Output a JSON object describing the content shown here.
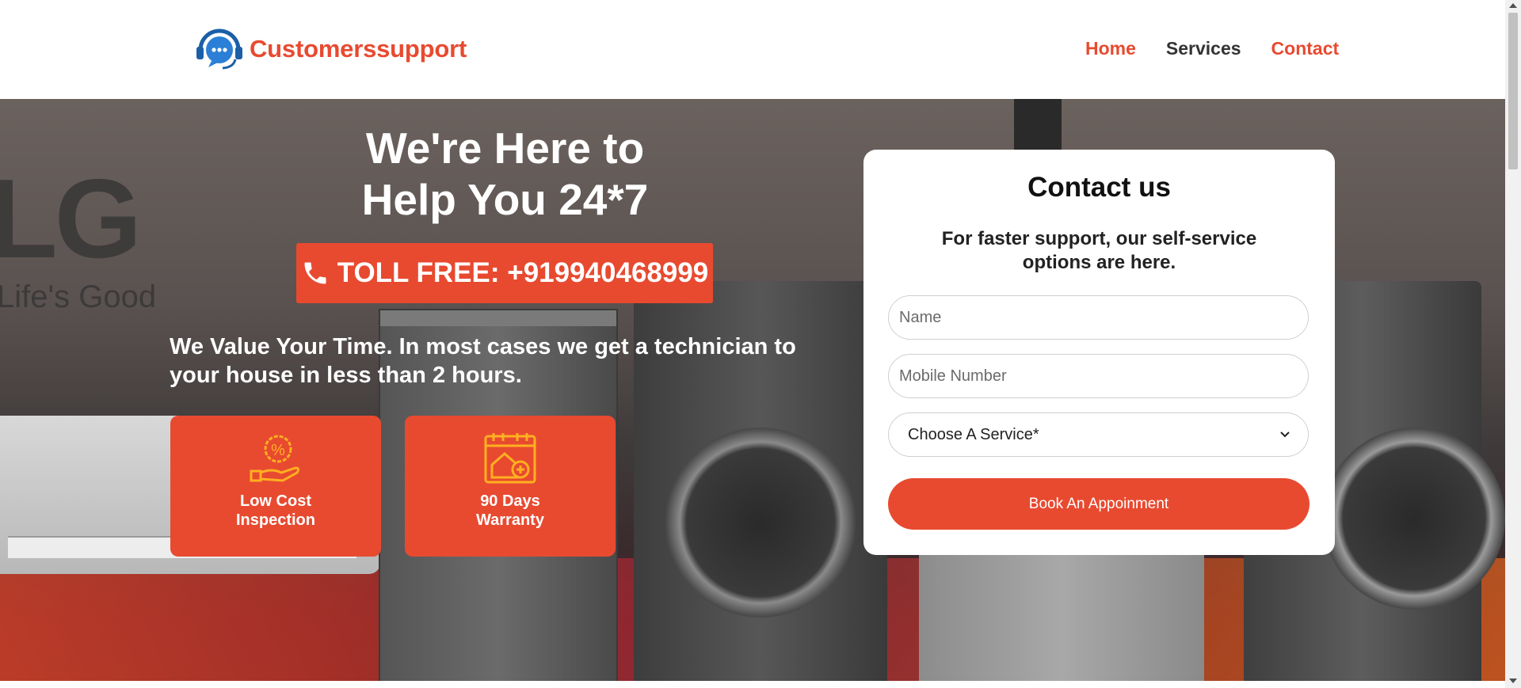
{
  "header": {
    "brand": "Customerssupport",
    "nav": [
      {
        "label": "Home",
        "color": "#e84a30"
      },
      {
        "label": "Services",
        "color": "#333333"
      },
      {
        "label": "Contact",
        "color": "#e84a30"
      }
    ]
  },
  "hero": {
    "background_brand": "LG",
    "background_tagline": "Life's Good",
    "title_line1": "We're Here to",
    "title_line2": "Help You 24*7",
    "tollfree": "TOLL FREE: +919940468999",
    "value_text": "We Value Your Time. In most cases we get a technician to your house in less than 2 hours.",
    "features": [
      {
        "icon": "discount-hand-icon",
        "line1": "Low Cost",
        "line2": "Inspection"
      },
      {
        "icon": "calendar-house-icon",
        "line1": "90 Days",
        "line2": "Warranty"
      }
    ]
  },
  "contact": {
    "title": "Contact us",
    "subtitle": "For faster support, our self-service options are here.",
    "name_placeholder": "Name",
    "mobile_placeholder": "Mobile Number",
    "service_selected": "Choose A Service*",
    "submit_label": "Book An Appoinment"
  },
  "colors": {
    "accent": "#e84a30",
    "nav_dark": "#333333",
    "card_bg": "#ffffff"
  }
}
